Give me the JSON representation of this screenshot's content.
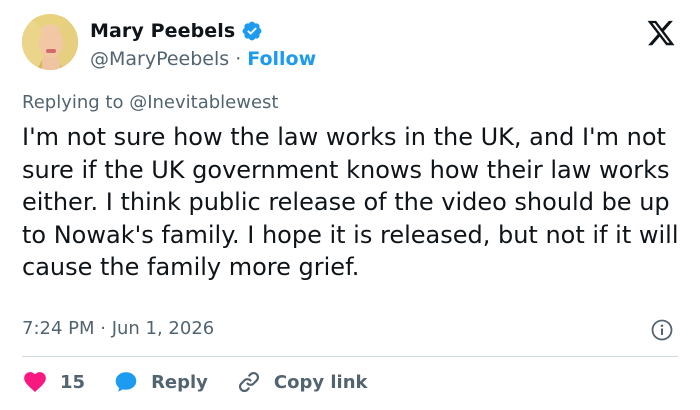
{
  "author": {
    "name": "Mary Peebels",
    "handle": "@MaryPeebels",
    "separator": "·",
    "follow_label": "Follow"
  },
  "reply": {
    "prefix": "Replying to",
    "mention": "@Inevitablewest"
  },
  "tweet": {
    "text": "I'm not sure how the law works in the UK, and I'm not sure if the UK government knows how their law works either. I think public release of the video should be up to Nowak's family. I hope it is released, but not if it will cause the family more grief.",
    "timestamp": "7:24 PM · Jun 1, 2026"
  },
  "actions": {
    "likes_count": "15",
    "reply_label": "Reply",
    "copy_link_label": "Copy link"
  },
  "colors": {
    "accent": "#1d9bf0",
    "like": "#f91880",
    "muted": "#536471",
    "text": "#0f1419"
  },
  "icons": [
    "verified-badge-icon",
    "x-logo-icon",
    "info-icon",
    "heart-icon",
    "reply-bubble-icon",
    "link-icon"
  ]
}
